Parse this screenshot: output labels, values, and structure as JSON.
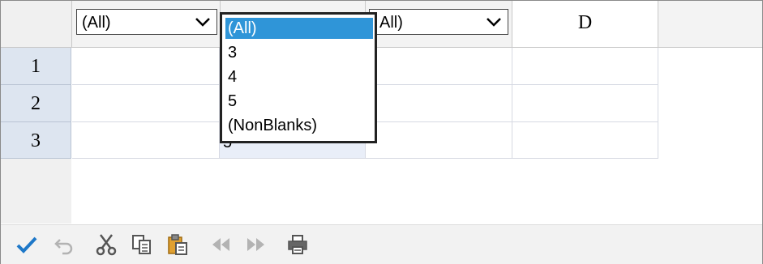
{
  "columns": {
    "a": {
      "filter_value": "(All)"
    },
    "b": {
      "filter_value": "(All)"
    },
    "c": {
      "filter_value": "All)"
    },
    "d": {
      "letter": "D"
    }
  },
  "rows": [
    {
      "label": "1"
    },
    {
      "label": "2"
    },
    {
      "label": "3"
    }
  ],
  "peek_text": "5",
  "dropdown": {
    "options": [
      "(All)",
      "3",
      "4",
      "5",
      "(NonBlanks)"
    ],
    "selected": "(All)"
  },
  "toolbar": {
    "buttons": [
      "check-icon",
      "undo-icon",
      "cut-icon",
      "copy-icon",
      "paste-icon",
      "prev-icon",
      "next-icon",
      "print-icon"
    ],
    "colors": {
      "check": "#1e78c8",
      "disabled": "#b3b3b3",
      "paste": "#e0a030",
      "icon": "#555555"
    }
  },
  "colors": {
    "row_header_bg": "#dde5f0",
    "selection_bg": "#2f95d8",
    "selected_cell_bg": "#e9eef8"
  }
}
